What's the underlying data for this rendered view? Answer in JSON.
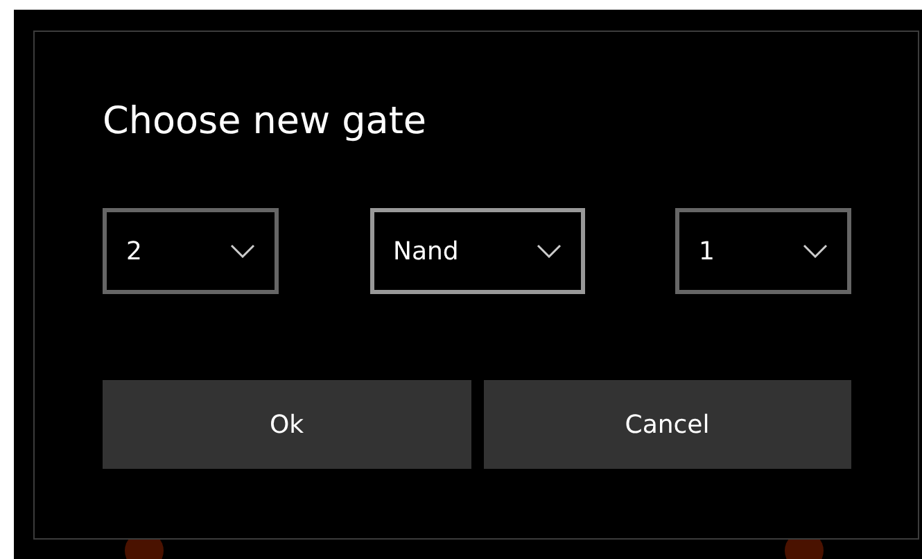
{
  "dialog": {
    "title": "Choose new gate",
    "dropdowns": [
      {
        "value": "2",
        "focused": false
      },
      {
        "value": "Nand",
        "focused": true
      },
      {
        "value": "1",
        "focused": false
      }
    ],
    "buttons": [
      "Ok",
      "Cancel"
    ]
  }
}
